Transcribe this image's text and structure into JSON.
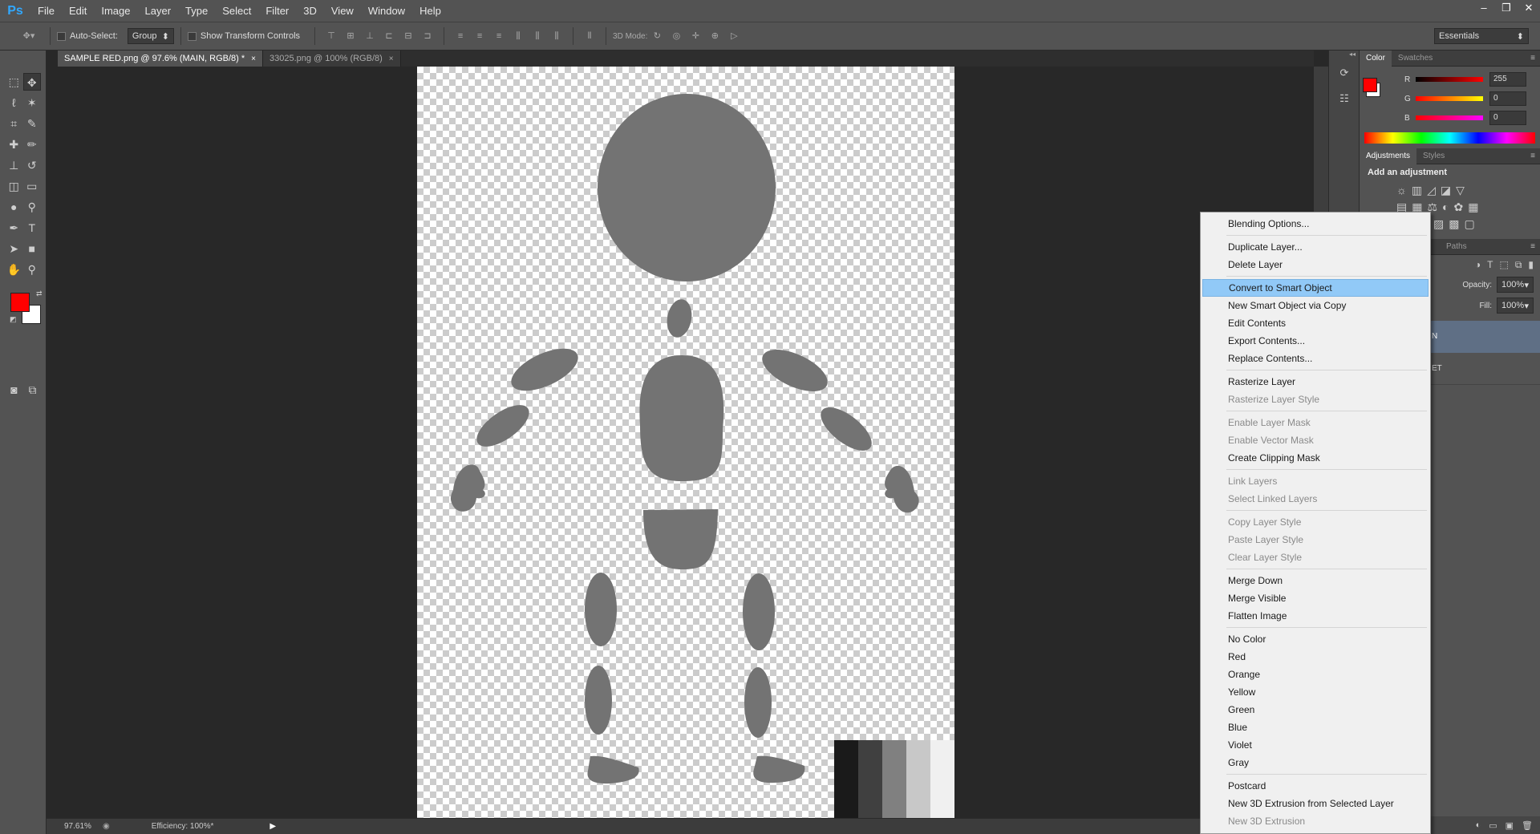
{
  "app": {
    "logo": "Ps",
    "window_controls": [
      "–",
      "❐",
      "✕"
    ]
  },
  "menu": [
    "File",
    "Edit",
    "Image",
    "Layer",
    "Type",
    "Select",
    "Filter",
    "3D",
    "View",
    "Window",
    "Help"
  ],
  "options_bar": {
    "auto_select_label": "Auto-Select:",
    "auto_select_value": "Group",
    "show_transform_label": "Show Transform Controls",
    "mode_3d_label": "3D Mode:",
    "workspace": "Essentials"
  },
  "tabs": [
    {
      "label": "SAMPLE RED.png @ 97.6% (MAIN, RGB/8) *",
      "close": "×"
    },
    {
      "label": "33025.png @ 100% (RGB/8)",
      "close": "×"
    }
  ],
  "status": {
    "zoom": "97.61%",
    "efficiency": "Efficiency: 100%*"
  },
  "color_panel": {
    "tabs": [
      "Color",
      "Swatches"
    ],
    "channels": [
      {
        "label": "R",
        "value": "255"
      },
      {
        "label": "G",
        "value": "0"
      },
      {
        "label": "B",
        "value": "0"
      }
    ],
    "foreground": "#ff0000",
    "background": "#ffffff"
  },
  "adjustments_panel": {
    "tabs": [
      "Adjustments",
      "Styles"
    ],
    "heading": "Add an adjustment"
  },
  "layers_panel": {
    "tab": "Paths",
    "opacity_label": "Opacity:",
    "opacity_value": "100%",
    "fill_label": "Fill:",
    "fill_value": "100%",
    "layer_fragments": [
      "N",
      "ET"
    ]
  },
  "context_menu": [
    [
      {
        "label": "Blending Options...",
        "enabled": true
      }
    ],
    [
      {
        "label": "Duplicate Layer...",
        "enabled": true
      },
      {
        "label": "Delete Layer",
        "enabled": true
      }
    ],
    [
      {
        "label": "Convert to Smart Object",
        "enabled": true,
        "highlighted": true
      },
      {
        "label": "New Smart Object via Copy",
        "enabled": true
      },
      {
        "label": "Edit Contents",
        "enabled": true
      },
      {
        "label": "Export Contents...",
        "enabled": true
      },
      {
        "label": "Replace Contents...",
        "enabled": true
      }
    ],
    [
      {
        "label": "Rasterize Layer",
        "enabled": true
      },
      {
        "label": "Rasterize Layer Style",
        "enabled": false
      }
    ],
    [
      {
        "label": "Enable Layer Mask",
        "enabled": false
      },
      {
        "label": "Enable Vector Mask",
        "enabled": false
      },
      {
        "label": "Create Clipping Mask",
        "enabled": true
      }
    ],
    [
      {
        "label": "Link Layers",
        "enabled": false
      },
      {
        "label": "Select Linked Layers",
        "enabled": false
      }
    ],
    [
      {
        "label": "Copy Layer Style",
        "enabled": false
      },
      {
        "label": "Paste Layer Style",
        "enabled": false
      },
      {
        "label": "Clear Layer Style",
        "enabled": false
      }
    ],
    [
      {
        "label": "Merge Down",
        "enabled": true
      },
      {
        "label": "Merge Visible",
        "enabled": true
      },
      {
        "label": "Flatten Image",
        "enabled": true
      }
    ],
    [
      {
        "label": "No Color",
        "enabled": true
      },
      {
        "label": "Red",
        "enabled": true
      },
      {
        "label": "Orange",
        "enabled": true
      },
      {
        "label": "Yellow",
        "enabled": true
      },
      {
        "label": "Green",
        "enabled": true
      },
      {
        "label": "Blue",
        "enabled": true
      },
      {
        "label": "Violet",
        "enabled": true
      },
      {
        "label": "Gray",
        "enabled": true
      }
    ],
    [
      {
        "label": "Postcard",
        "enabled": true
      },
      {
        "label": "New 3D Extrusion from Selected Layer",
        "enabled": true
      },
      {
        "label": "New 3D Extrusion",
        "enabled": false
      }
    ]
  ],
  "canvas": {
    "figure_color": "#737373",
    "swatch_strip": [
      "#1a1a1a",
      "#404040",
      "#808080",
      "#c8c8c8",
      "#f0f0f0"
    ]
  }
}
